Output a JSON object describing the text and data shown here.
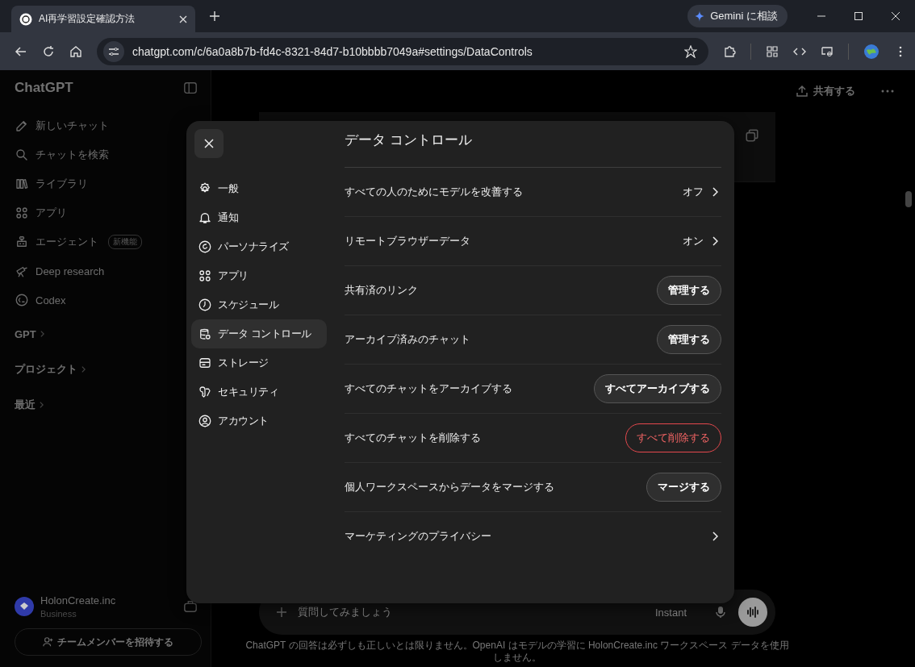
{
  "browser": {
    "tab_title": "AI再学習設定確認方法",
    "gemini_button": "Gemini に相談",
    "url": "chatgpt.com/c/6a0a8b7b-fd4c-8321-84d7-b10bbbb7049a#settings/DataControls"
  },
  "sidebar": {
    "brand": "ChatGPT",
    "items": [
      {
        "label": "新しいチャット"
      },
      {
        "label": "チャットを検索"
      },
      {
        "label": "ライブラリ"
      },
      {
        "label": "アプリ"
      },
      {
        "label": "エージェント",
        "badge": "新機能"
      },
      {
        "label": "Deep research"
      },
      {
        "label": "Codex"
      }
    ],
    "sections": [
      "GPT",
      "プロジェクト",
      "最近"
    ],
    "account": {
      "name": "HolonCreate.inc",
      "plan": "Business"
    },
    "invite_button": "チームメンバーを招待する"
  },
  "header": {
    "share_button": "共有する"
  },
  "composer": {
    "placeholder": "質問してみましょう",
    "model": "Instant"
  },
  "disclaimer": "ChatGPT の回答は必ずしも正しいとは限りません。OpenAI はモデルの学習に HolonCreate.inc ワークスペース データを使用しません。",
  "settings": {
    "nav": [
      {
        "label": "一般",
        "selected": false
      },
      {
        "label": "通知",
        "selected": false
      },
      {
        "label": "パーソナライズ",
        "selected": false
      },
      {
        "label": "アプリ",
        "selected": false
      },
      {
        "label": "スケジュール",
        "selected": false
      },
      {
        "label": "データ コントロール",
        "selected": true
      },
      {
        "label": "ストレージ",
        "selected": false
      },
      {
        "label": "セキュリティ",
        "selected": false
      },
      {
        "label": "アカウント",
        "selected": false
      }
    ],
    "title": "データ コントロール",
    "rows": [
      {
        "kind": "link",
        "label": "すべての人のためにモデルを改善する",
        "value": "オフ"
      },
      {
        "kind": "link",
        "label": "リモートブラウザーデータ",
        "value": "オン"
      },
      {
        "kind": "button",
        "label": "共有済のリンク",
        "button": "管理する"
      },
      {
        "kind": "button",
        "label": "アーカイブ済みのチャット",
        "button": "管理する"
      },
      {
        "kind": "button",
        "label": "すべてのチャットをアーカイブする",
        "button": "すべてアーカイブする"
      },
      {
        "kind": "danger",
        "label": "すべてのチャットを削除する",
        "button": "すべて削除する"
      },
      {
        "kind": "button",
        "label": "個人ワークスペースからデータをマージする",
        "button": "マージする"
      },
      {
        "kind": "link",
        "label": "マーケティングのプライバシー"
      }
    ]
  }
}
